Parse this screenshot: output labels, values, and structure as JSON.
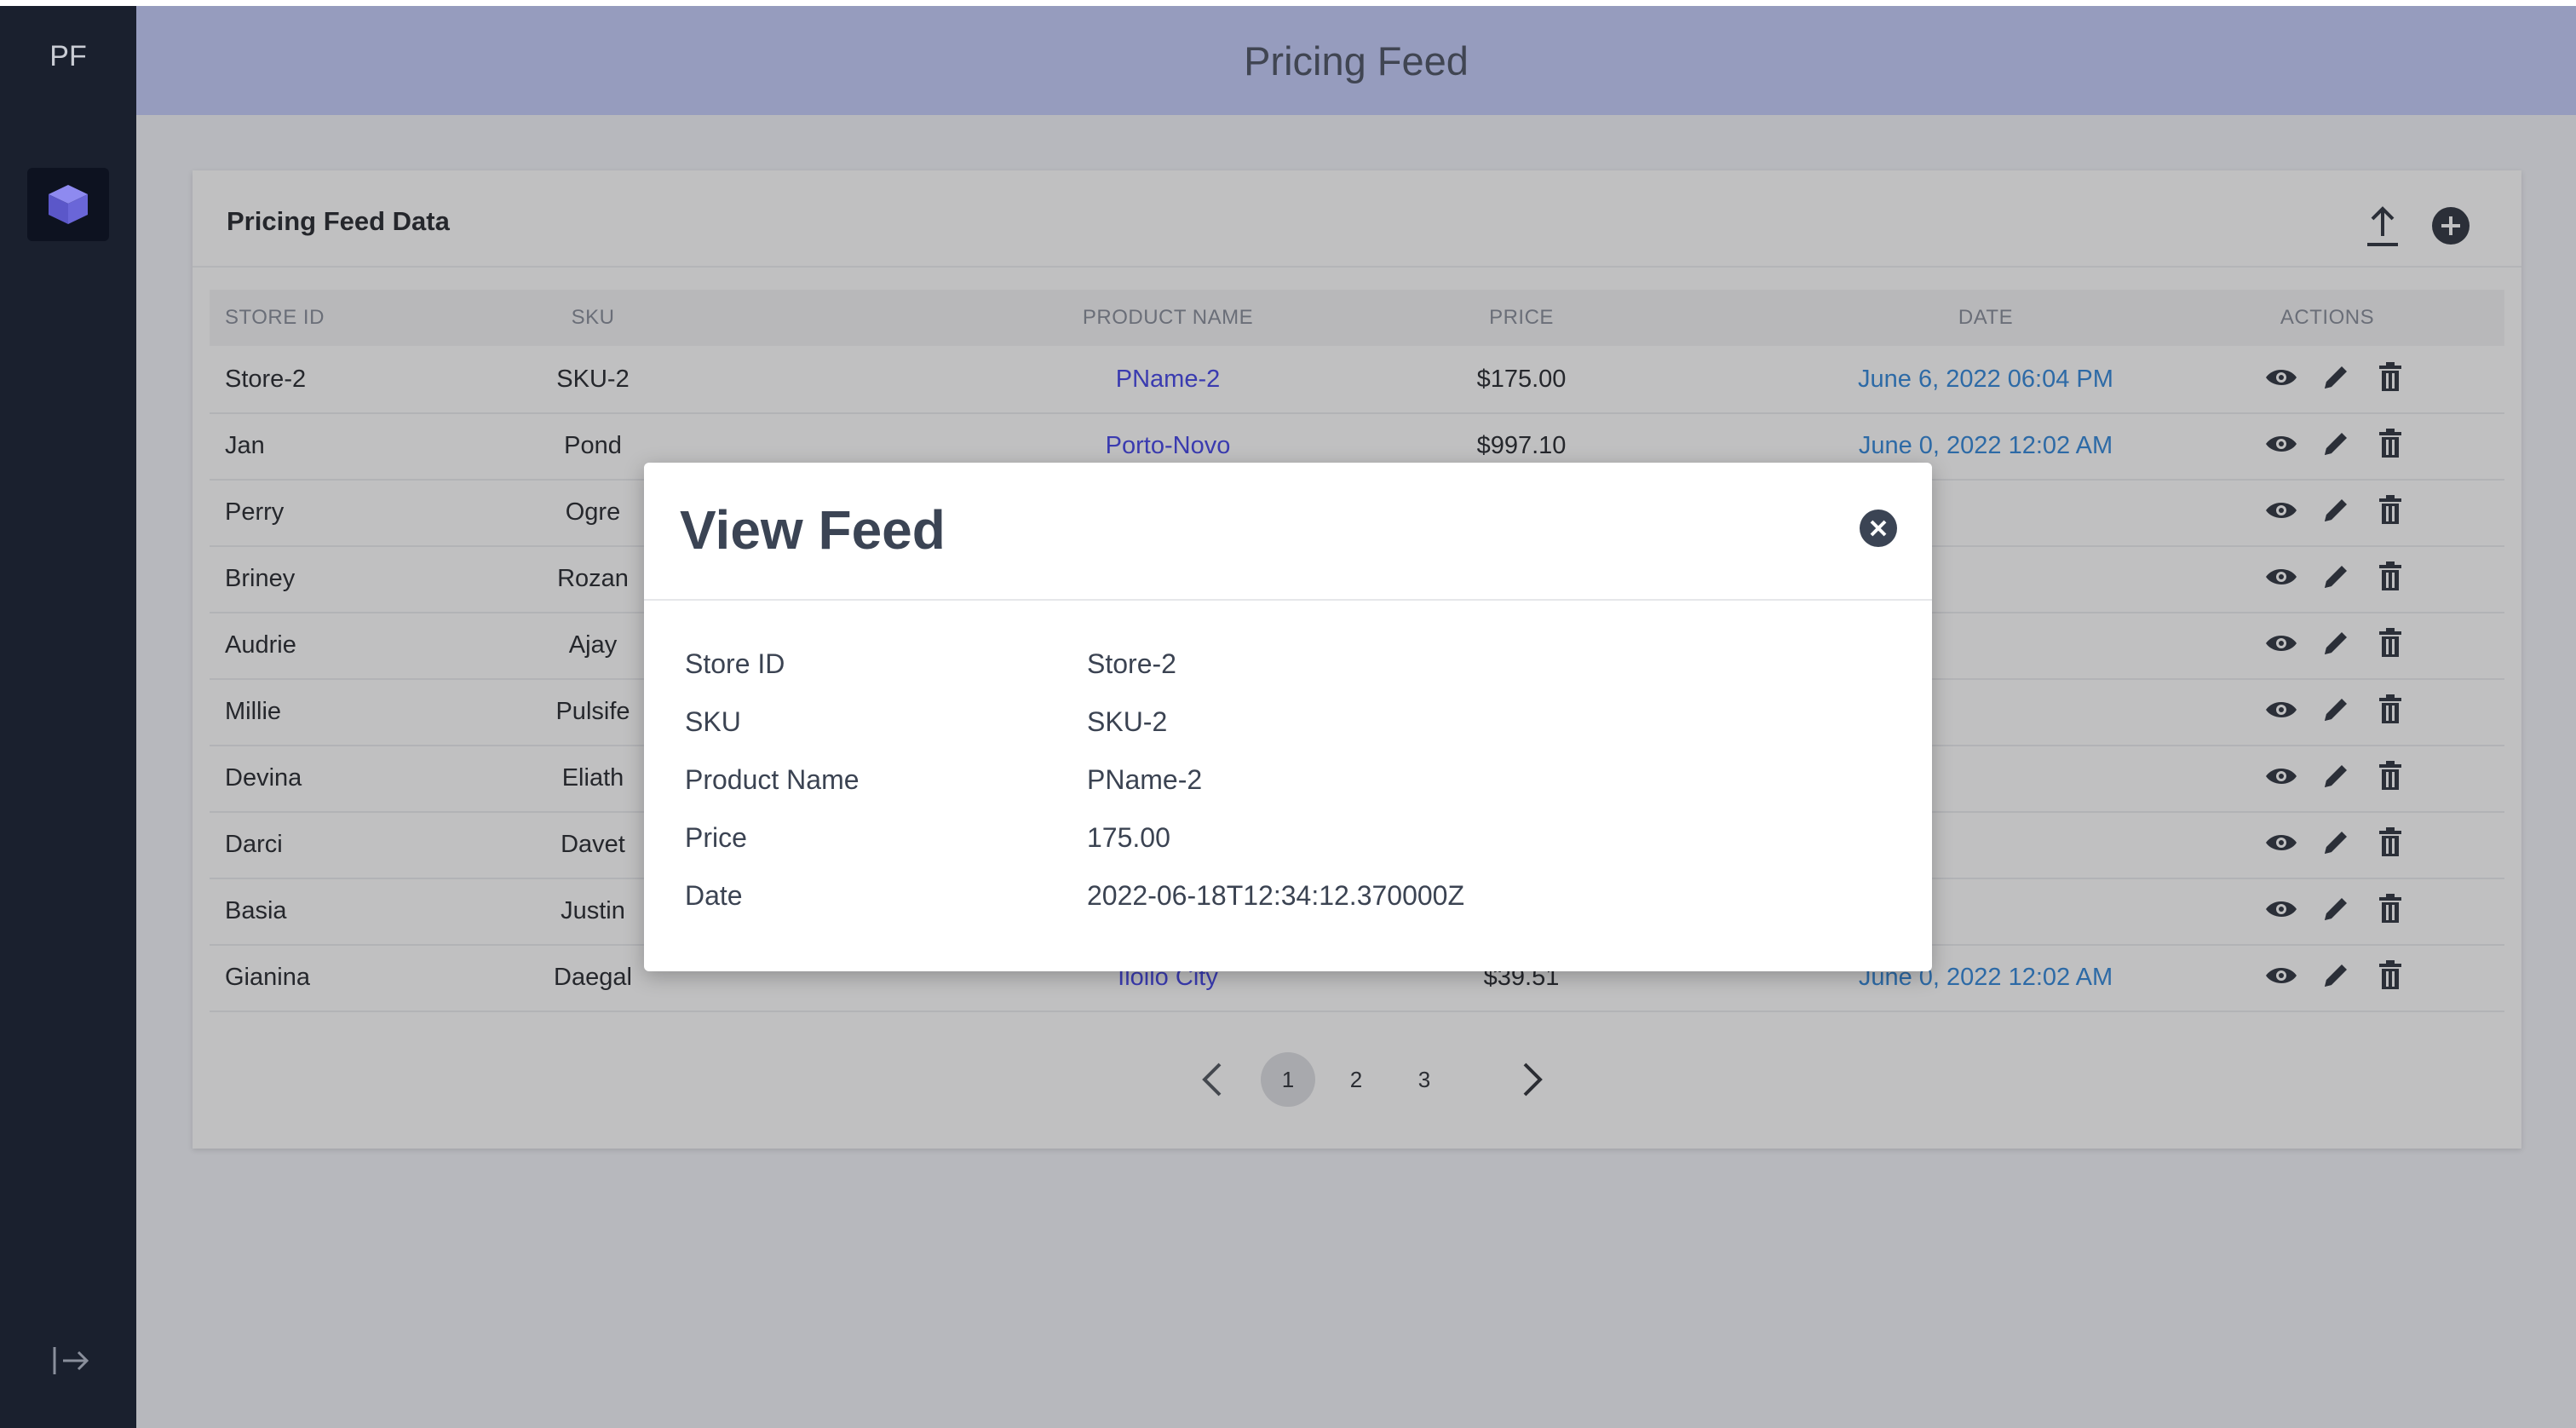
{
  "app": {
    "brand": "PF",
    "title": "Pricing Feed"
  },
  "card": {
    "title": "Pricing Feed Data"
  },
  "table": {
    "headers": {
      "store_id": "STORE ID",
      "sku": "SKU",
      "product_name": "PRODUCT NAME",
      "price": "PRICE",
      "date": "DATE",
      "actions": "ACTIONS"
    },
    "rows": [
      {
        "store": "Store-2",
        "sku": "SKU-2",
        "name": "PName-2",
        "price": "$175.00",
        "date": "June 6, 2022 06:04 PM"
      },
      {
        "store": "Jan",
        "sku": "Pond",
        "name": "Porto-Novo",
        "price": "$997.10",
        "date": "June 0, 2022 12:02 AM"
      },
      {
        "store": "Perry",
        "sku": "Ogre",
        "name": "",
        "price": "",
        "date": ""
      },
      {
        "store": "Briney",
        "sku": "Rozan",
        "name": "",
        "price": "",
        "date": ""
      },
      {
        "store": "Audrie",
        "sku": "Ajay",
        "name": "",
        "price": "",
        "date": ""
      },
      {
        "store": "Millie",
        "sku": "Pulsife",
        "name": "",
        "price": "",
        "date": ""
      },
      {
        "store": "Devina",
        "sku": "Eliath",
        "name": "",
        "price": "",
        "date": ""
      },
      {
        "store": "Darci",
        "sku": "Davet",
        "name": "",
        "price": "",
        "date": ""
      },
      {
        "store": "Basia",
        "sku": "Justin",
        "name": "",
        "price": "",
        "date": ""
      },
      {
        "store": "Gianina",
        "sku": "Daegal",
        "name": "Iloilo City",
        "price": "$39.51",
        "date": "June 0, 2022 12:02 AM"
      }
    ]
  },
  "pagination": {
    "pages": [
      "1",
      "2",
      "3"
    ],
    "current": "1"
  },
  "modal": {
    "title": "View Feed",
    "fields": [
      {
        "label": "Store ID",
        "value": "Store-2"
      },
      {
        "label": "SKU",
        "value": "SKU-2"
      },
      {
        "label": "Product Name",
        "value": "PName-2"
      },
      {
        "label": "Price",
        "value": "175.00"
      },
      {
        "label": "Date",
        "value": "2022-06-18T12:34:12.370000Z"
      }
    ]
  },
  "icons": {
    "sidebar_item": "cube-icon",
    "logout": "logout-icon",
    "upload": "upload-icon",
    "add": "add-circle-icon",
    "view": "eye-icon",
    "edit": "pencil-icon",
    "delete": "trash-icon",
    "close": "close-circle-icon",
    "prev": "chevron-left-icon",
    "next": "chevron-right-icon"
  },
  "colors": {
    "sidebar": "#1a202e",
    "header": "#969cbe",
    "link": "#3a3bb0",
    "date": "#2d6aa6",
    "cube_accent": "#6a66d8"
  }
}
